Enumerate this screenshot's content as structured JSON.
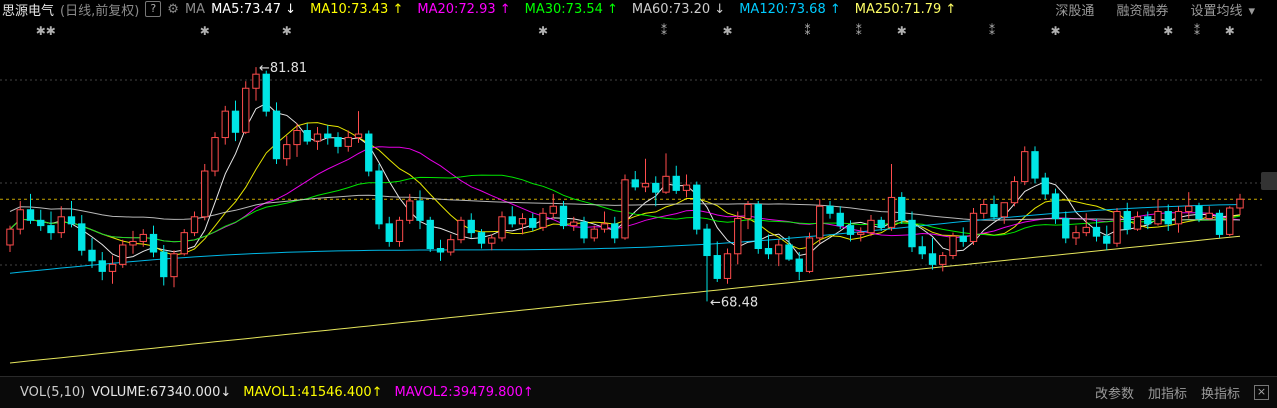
{
  "header": {
    "stock_name": "思源电气",
    "mode": "(日线,前复权)",
    "help": "?",
    "ma_label": "MA",
    "mas": [
      {
        "text": "MA5:73.47",
        "arrow": "↓",
        "color": "#ffffff"
      },
      {
        "text": "MA10:73.43",
        "arrow": "↑",
        "color": "#ffff00"
      },
      {
        "text": "MA20:72.93",
        "arrow": "↑",
        "color": "#ff00ff"
      },
      {
        "text": "MA30:73.54",
        "arrow": "↑",
        "color": "#00ff00"
      },
      {
        "text": "MA60:73.20",
        "arrow": "↓",
        "color": "#cccccc"
      },
      {
        "text": "MA120:73.68",
        "arrow": "↑",
        "color": "#00ccff"
      },
      {
        "text": "MA250:71.79",
        "arrow": "↑",
        "color": "#ffff66"
      }
    ],
    "tools": [
      "深股通",
      "融资融券",
      "设置均线"
    ],
    "settings_caret": "▾"
  },
  "chart_data": {
    "type": "candlestick",
    "annotations": [
      {
        "text": "81.81",
        "marker": "←"
      },
      {
        "text": "68.48",
        "marker": "←"
      }
    ],
    "high_label": "81.81",
    "low_label": "68.48",
    "colors": {
      "up": "#ff4d4d",
      "down": "#00e5e5"
    },
    "candles": [
      [
        71.7,
        72.8,
        71.3,
        72.6
      ],
      [
        72.6,
        74.2,
        72.3,
        73.7
      ],
      [
        73.7,
        74.6,
        72.9,
        73.1
      ],
      [
        73.1,
        73.7,
        72.5,
        72.8
      ],
      [
        72.8,
        73.6,
        72.0,
        72.4
      ],
      [
        72.4,
        73.9,
        72.1,
        73.3
      ],
      [
        73.3,
        74.2,
        72.7,
        72.9
      ],
      [
        72.9,
        73.4,
        71.1,
        71.4
      ],
      [
        71.4,
        72.1,
        70.4,
        70.8
      ],
      [
        70.8,
        71.3,
        69.7,
        70.2
      ],
      [
        70.2,
        71.1,
        69.5,
        70.6
      ],
      [
        70.6,
        72.0,
        70.4,
        71.7
      ],
      [
        71.7,
        72.5,
        71.2,
        71.9
      ],
      [
        71.9,
        72.6,
        71.6,
        72.3
      ],
      [
        72.3,
        72.8,
        71.0,
        71.3
      ],
      [
        71.3,
        71.7,
        69.4,
        69.9
      ],
      [
        69.9,
        71.4,
        69.3,
        71.2
      ],
      [
        71.2,
        72.6,
        71.1,
        72.4
      ],
      [
        72.4,
        73.6,
        72.2,
        73.3
      ],
      [
        73.3,
        76.3,
        73.1,
        75.9
      ],
      [
        75.9,
        78.1,
        75.6,
        77.8
      ],
      [
        77.8,
        79.6,
        77.4,
        79.3
      ],
      [
        79.3,
        79.9,
        77.6,
        78.1
      ],
      [
        78.1,
        81.0,
        78.0,
        80.6
      ],
      [
        80.6,
        81.8,
        79.9,
        81.4
      ],
      [
        81.4,
        81.6,
        79.0,
        79.3
      ],
      [
        79.3,
        79.8,
        76.3,
        76.6
      ],
      [
        76.6,
        77.9,
        76.2,
        77.4
      ],
      [
        77.4,
        78.6,
        76.7,
        78.2
      ],
      [
        78.2,
        78.6,
        77.4,
        77.6
      ],
      [
        77.6,
        78.4,
        77.1,
        78.0
      ],
      [
        78.0,
        78.5,
        77.4,
        77.8
      ],
      [
        77.8,
        78.1,
        76.9,
        77.3
      ],
      [
        77.3,
        78.2,
        77.0,
        77.8
      ],
      [
        77.8,
        79.3,
        77.5,
        78.0
      ],
      [
        78.0,
        78.2,
        75.6,
        75.9
      ],
      [
        75.9,
        76.3,
        72.6,
        72.9
      ],
      [
        72.9,
        73.3,
        71.6,
        71.9
      ],
      [
        71.9,
        73.3,
        71.6,
        73.1
      ],
      [
        73.1,
        74.6,
        72.9,
        74.2
      ],
      [
        74.2,
        74.8,
        72.6,
        73.1
      ],
      [
        73.1,
        73.3,
        71.3,
        71.5
      ],
      [
        71.5,
        72.0,
        70.8,
        71.3
      ],
      [
        71.3,
        72.3,
        71.1,
        72.0
      ],
      [
        72.0,
        73.3,
        71.8,
        73.1
      ],
      [
        73.1,
        73.5,
        72.1,
        72.4
      ],
      [
        72.4,
        72.6,
        71.5,
        71.8
      ],
      [
        71.8,
        72.3,
        71.4,
        72.1
      ],
      [
        72.1,
        73.6,
        71.9,
        73.3
      ],
      [
        73.3,
        73.9,
        72.7,
        72.9
      ],
      [
        72.9,
        73.5,
        72.3,
        73.2
      ],
      [
        73.2,
        73.5,
        72.5,
        72.7
      ],
      [
        72.7,
        73.8,
        72.5,
        73.5
      ],
      [
        73.5,
        74.6,
        73.2,
        73.9
      ],
      [
        73.9,
        74.2,
        72.6,
        72.8
      ],
      [
        72.8,
        73.3,
        72.5,
        73.0
      ],
      [
        73.0,
        73.3,
        71.8,
        72.1
      ],
      [
        72.1,
        72.8,
        71.9,
        72.6
      ],
      [
        72.6,
        73.6,
        72.4,
        72.9
      ],
      [
        72.9,
        73.3,
        71.8,
        72.1
      ],
      [
        72.1,
        75.7,
        72.0,
        75.4
      ],
      [
        75.4,
        75.9,
        74.8,
        75.0
      ],
      [
        75.0,
        76.6,
        74.7,
        75.2
      ],
      [
        75.2,
        75.6,
        73.9,
        74.7
      ],
      [
        74.7,
        76.9,
        74.6,
        75.6
      ],
      [
        75.6,
        76.2,
        74.6,
        74.8
      ],
      [
        74.8,
        75.7,
        74.4,
        75.1
      ],
      [
        75.1,
        75.3,
        72.3,
        72.6
      ],
      [
        72.6,
        72.9,
        68.5,
        71.1
      ],
      [
        71.1,
        71.9,
        69.6,
        69.8
      ],
      [
        69.8,
        71.5,
        69.5,
        71.2
      ],
      [
        71.2,
        73.6,
        70.6,
        73.2
      ],
      [
        73.2,
        74.2,
        72.6,
        74.0
      ],
      [
        74.0,
        74.2,
        71.2,
        71.5
      ],
      [
        71.5,
        72.3,
        70.9,
        71.2
      ],
      [
        71.2,
        72.0,
        70.5,
        71.7
      ],
      [
        71.7,
        72.2,
        70.8,
        70.9
      ],
      [
        70.9,
        71.3,
        69.7,
        70.2
      ],
      [
        70.2,
        72.4,
        70.1,
        72.1
      ],
      [
        72.1,
        74.3,
        71.8,
        73.9
      ],
      [
        73.9,
        74.2,
        73.2,
        73.5
      ],
      [
        73.5,
        73.9,
        72.6,
        72.8
      ],
      [
        72.8,
        73.1,
        71.9,
        72.3
      ],
      [
        72.3,
        72.7,
        71.9,
        72.4
      ],
      [
        72.4,
        73.4,
        72.2,
        73.1
      ],
      [
        73.1,
        73.3,
        72.5,
        72.7
      ],
      [
        72.7,
        76.3,
        72.5,
        74.4
      ],
      [
        74.4,
        74.7,
        72.9,
        73.1
      ],
      [
        73.1,
        73.6,
        71.3,
        71.6
      ],
      [
        71.6,
        72.2,
        70.9,
        71.2
      ],
      [
        71.2,
        72.1,
        70.3,
        70.6
      ],
      [
        70.6,
        71.3,
        70.2,
        71.1
      ],
      [
        71.1,
        72.4,
        70.9,
        72.2
      ],
      [
        72.2,
        72.7,
        71.6,
        71.9
      ],
      [
        71.9,
        73.8,
        71.7,
        73.5
      ],
      [
        73.5,
        74.3,
        73.2,
        74.0
      ],
      [
        74.0,
        74.5,
        73.1,
        73.3
      ],
      [
        73.3,
        74.1,
        72.9,
        74.1
      ],
      [
        74.1,
        75.6,
        73.9,
        75.3
      ],
      [
        75.3,
        77.3,
        75.1,
        77.0
      ],
      [
        77.0,
        77.3,
        75.2,
        75.5
      ],
      [
        75.5,
        75.8,
        74.3,
        74.6
      ],
      [
        74.6,
        74.9,
        72.9,
        73.2
      ],
      [
        73.2,
        73.6,
        71.8,
        72.1
      ],
      [
        72.1,
        72.8,
        71.7,
        72.4
      ],
      [
        72.4,
        73.5,
        72.2,
        72.7
      ],
      [
        72.7,
        73.2,
        71.9,
        72.2
      ],
      [
        72.2,
        72.8,
        71.4,
        71.8
      ],
      [
        71.8,
        73.8,
        71.6,
        73.6
      ],
      [
        73.6,
        74.1,
        72.3,
        72.6
      ],
      [
        72.6,
        73.6,
        72.5,
        73.3
      ],
      [
        73.3,
        73.6,
        72.6,
        72.9
      ],
      [
        72.9,
        74.3,
        72.8,
        73.6
      ],
      [
        73.6,
        74.0,
        72.5,
        72.9
      ],
      [
        72.9,
        73.9,
        72.4,
        73.6
      ],
      [
        73.6,
        74.7,
        73.2,
        73.9
      ],
      [
        73.9,
        74.1,
        73.0,
        73.2
      ],
      [
        73.2,
        73.9,
        73.1,
        73.5
      ],
      [
        73.5,
        73.7,
        72.1,
        72.3
      ],
      [
        72.3,
        73.9,
        72.2,
        73.8
      ],
      [
        73.8,
        74.6,
        73.4,
        74.3
      ]
    ],
    "ma_series": [
      {
        "name": "MA5",
        "color": "#ffffff"
      },
      {
        "name": "MA10",
        "color": "#ffff00"
      },
      {
        "name": "MA20",
        "color": "#ff00ff"
      },
      {
        "name": "MA30",
        "color": "#00ff00"
      },
      {
        "name": "MA60",
        "color": "#cccccc"
      },
      {
        "name": "MA120",
        "color": "#00ccff"
      },
      {
        "name": "MA250",
        "color": "#ffff66"
      }
    ],
    "ma250_start": 65.0,
    "ma250_end": 72.2,
    "ma120_start": 70.1,
    "ma120_end": 73.7,
    "ma60_start": 74.6,
    "ma60_end": 73.2,
    "markers": [
      {
        "index": 3,
        "glyph": "✱✱"
      },
      {
        "index": 19,
        "glyph": "✱"
      },
      {
        "index": 27,
        "glyph": "✱"
      },
      {
        "index": 52,
        "glyph": "✱"
      },
      {
        "index": 64,
        "glyph": "⁑"
      },
      {
        "index": 70,
        "glyph": "✱"
      },
      {
        "index": 78,
        "glyph": "⁑"
      },
      {
        "index": 83,
        "glyph": "⁑"
      },
      {
        "index": 87,
        "glyph": "✱"
      },
      {
        "index": 96,
        "glyph": "⁑"
      },
      {
        "index": 102,
        "glyph": "✱"
      },
      {
        "index": 113,
        "glyph": "✱"
      },
      {
        "index": 116,
        "glyph": "⁑"
      },
      {
        "index": 119,
        "glyph": "✱"
      }
    ]
  },
  "volume_bar": {
    "label": "VOL(5,10)",
    "volume": "VOLUME:67340.000",
    "volume_arrow": "↓",
    "mavol1": "MAVOL1:41546.400",
    "mavol1_arrow": "↑",
    "mavol2": "MAVOL2:39479.800",
    "mavol2_arrow": "↑",
    "tools": [
      "改参数",
      "加指标",
      "换指标"
    ],
    "close": "×"
  }
}
